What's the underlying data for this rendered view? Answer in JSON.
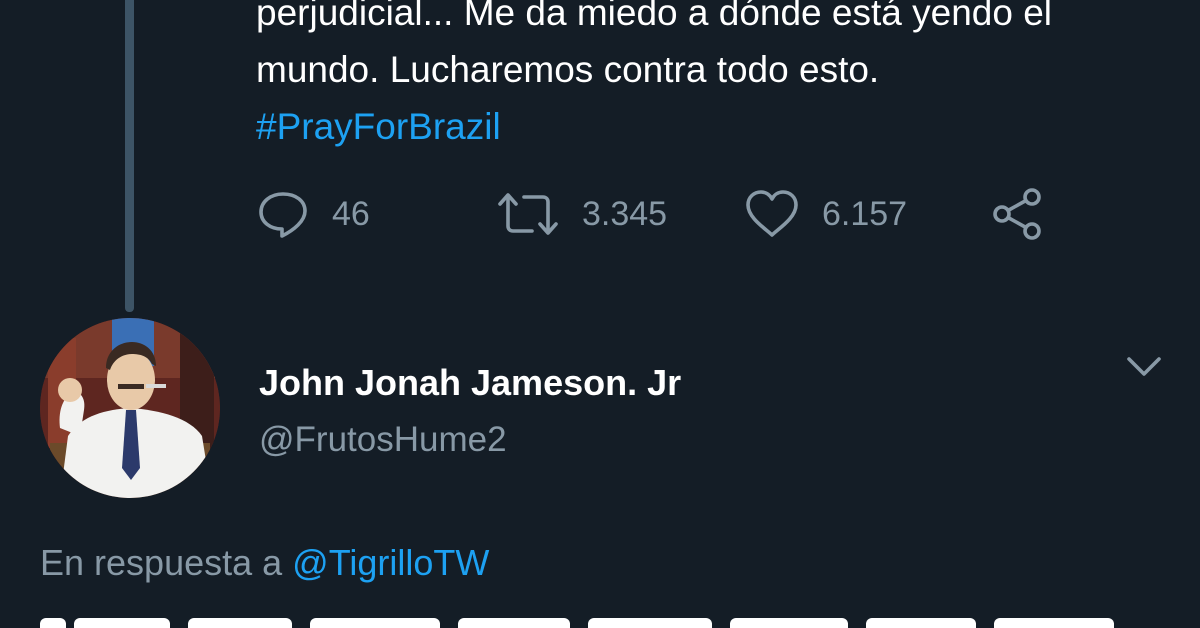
{
  "tweet": {
    "lines": [
      "perjudicial... Me da miedo a dónde está yendo el",
      "mundo. Lucharemos contra todo esto."
    ],
    "hashtag": "#PrayForBrazil",
    "actions": {
      "replies": "46",
      "retweets": "3.345",
      "likes": "6.157"
    }
  },
  "reply_tweet": {
    "name": "John Jonah Jameson. Jr",
    "handle": "@FrutosHume2",
    "reply_prefix": "En respuesta a",
    "reply_mention": "@TigrilloTW"
  },
  "icons": {
    "reply": "speech-bubble-icon",
    "retweet": "retweet-icon",
    "like": "heart-icon",
    "share": "share-icon",
    "menu": "chevron-down-icon"
  },
  "colors": {
    "background": "#141d26",
    "link": "#1da1f2",
    "muted": "#8899a6",
    "thread_line": "#3d5466"
  }
}
